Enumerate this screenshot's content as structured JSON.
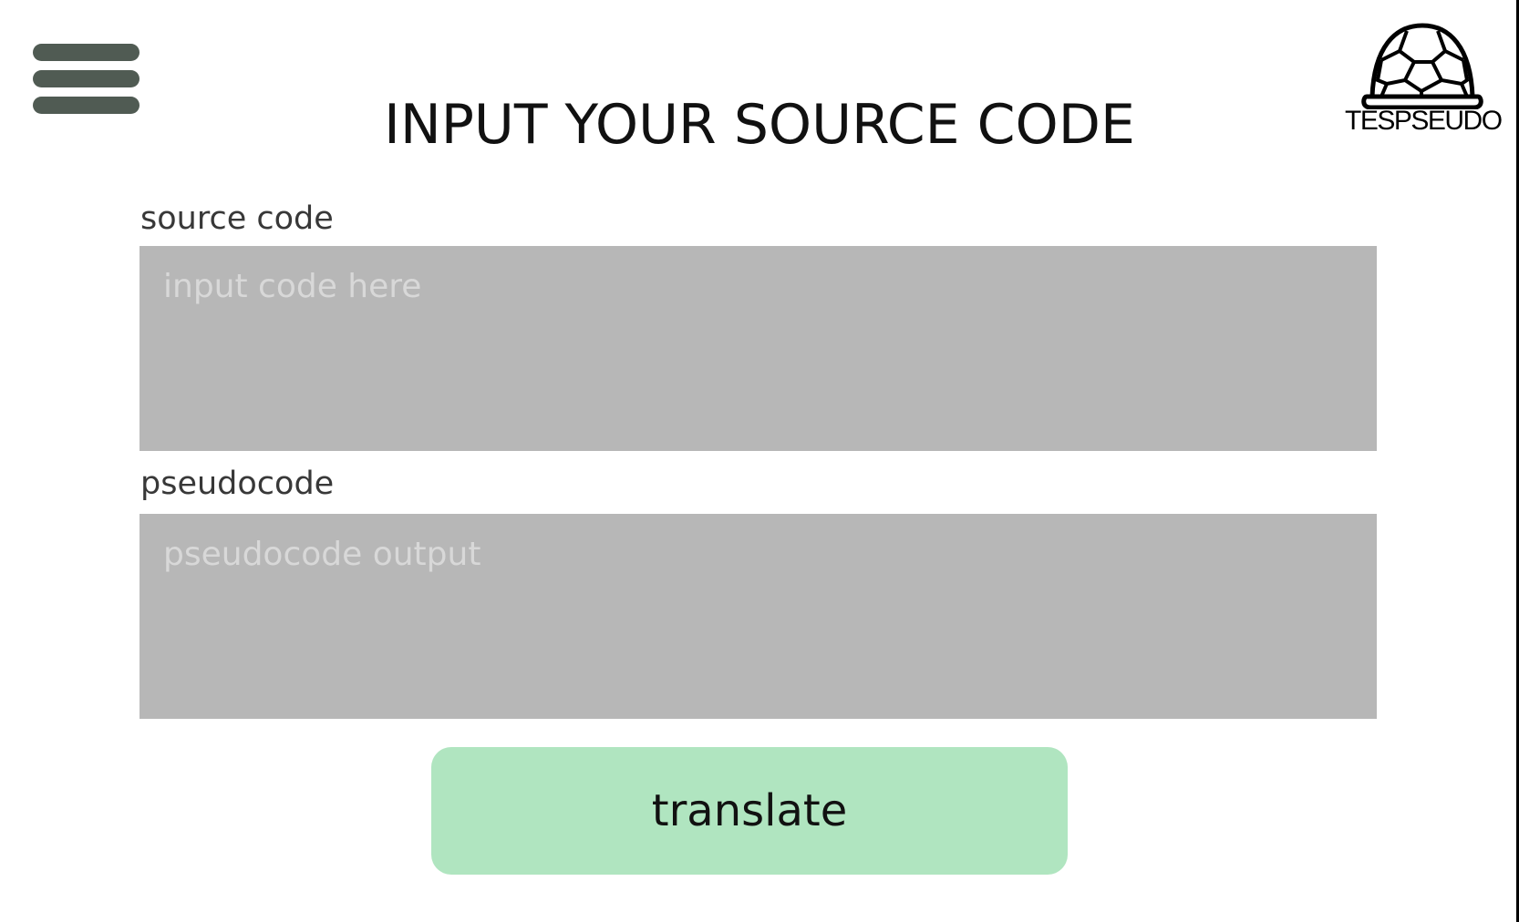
{
  "header": {
    "menu_icon": "hamburger-menu-icon",
    "title": "INPUT YOUR SOURCE CODE",
    "logo": {
      "icon": "turtle-shell-icon",
      "text": "TESPSEUDO"
    }
  },
  "source_field": {
    "label": "source code",
    "placeholder": "input code here",
    "value": ""
  },
  "pseudocode_field": {
    "label": "pseudocode",
    "placeholder": "pseudocode output",
    "value": ""
  },
  "actions": {
    "translate_label": "translate"
  },
  "colors": {
    "menu_icon": "#505b53",
    "field_background": "#b7b7b7",
    "placeholder_text": "#d8d8d8",
    "button_background": "#b0e5c0",
    "title_text": "#111111"
  }
}
